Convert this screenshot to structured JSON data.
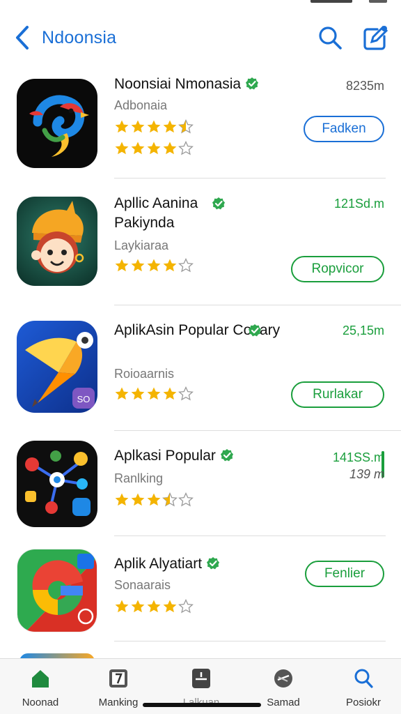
{
  "header": {
    "back_icon": "chevron-left-icon",
    "title": "Ndoonsia",
    "search_icon": "search-icon",
    "compose_icon": "compose-icon"
  },
  "colors": {
    "accent_blue": "#1a6fd6",
    "accent_green": "#1a9e3c",
    "star_gold": "#f4b400",
    "verified_green": "#2fa84f"
  },
  "apps": [
    {
      "name": "Noonsiai Nmonasia",
      "subtitle": "Adbonaia",
      "size": "8235m",
      "button": "Fadken",
      "rating_rows": [
        4.5,
        4
      ],
      "icon": "swirl-bird-icon"
    },
    {
      "name": "Apllic Aanina Pakiynda",
      "subtitle": "Laykiaraa",
      "size": "121Sd.m",
      "button": "Ropvicor",
      "rating_rows": [
        4
      ],
      "icon": "monkey-character-icon"
    },
    {
      "name": "AplikAsin Popular Coeary",
      "subtitle": "Roioaarnis",
      "size": "25,15m",
      "button": "Rurlakar",
      "rating_rows": [
        4
      ],
      "icon": "pencil-bird-icon"
    },
    {
      "name": "Aplkasi Popular",
      "subtitle": "Ranlking",
      "size": "141SS.m",
      "size2": "139 m",
      "button": "",
      "rating_rows": [
        3.5
      ],
      "icon": "network-dots-icon"
    },
    {
      "name": "Aplik Alyatiart",
      "subtitle": "Sonaarais",
      "size": "",
      "button": "Fenlier",
      "rating_rows": [
        4
      ],
      "icon": "google-style-icon"
    }
  ],
  "tabs": [
    {
      "label": "Noonad",
      "icon": "home-icon",
      "active": true
    },
    {
      "label": "Manking",
      "icon": "ranking-icon"
    },
    {
      "label": "Lalkuan",
      "icon": "apps-icon"
    },
    {
      "label": "Samad",
      "icon": "games-icon"
    },
    {
      "label": "Posiokr",
      "icon": "search-icon"
    }
  ]
}
